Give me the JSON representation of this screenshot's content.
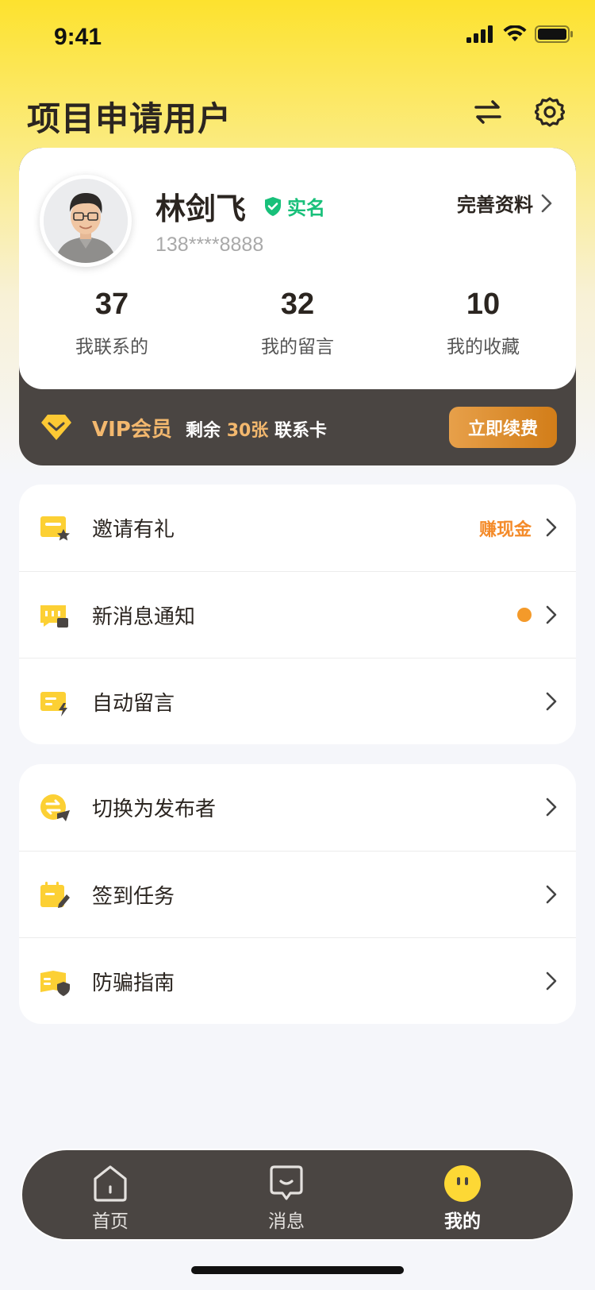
{
  "status_bar": {
    "time": "9:41"
  },
  "header": {
    "title": "项目申请用户",
    "switch_icon": "switch-arrows-icon",
    "settings_icon": "gear-icon"
  },
  "profile": {
    "name": "林剑飞",
    "verified_label": "实名",
    "phone": "138****8888",
    "complete_label": "完善资料",
    "stats": [
      {
        "value": "37",
        "label": "我联系的"
      },
      {
        "value": "32",
        "label": "我的留言"
      },
      {
        "value": "10",
        "label": "我的收藏"
      }
    ]
  },
  "vip": {
    "title": "VIP会员",
    "remaining_prefix": "剩余",
    "remaining_count": "30张",
    "remaining_suffix": "联系卡",
    "renew_label": "立即续费"
  },
  "menu_group_1": [
    {
      "label": "邀请有礼",
      "extra": "赚现金",
      "icon": "gift-card-icon"
    },
    {
      "label": "新消息通知",
      "icon": "message-notice-icon"
    },
    {
      "label": "自动留言",
      "icon": "auto-message-icon"
    }
  ],
  "menu_group_2": [
    {
      "label": "切换为发布者",
      "icon": "switch-publisher-icon"
    },
    {
      "label": "签到任务",
      "icon": "checkin-calendar-icon"
    },
    {
      "label": "防骗指南",
      "icon": "shield-guide-icon"
    }
  ],
  "tabbar": [
    {
      "label": "首页",
      "icon": "home-icon"
    },
    {
      "label": "消息",
      "icon": "chat-icon"
    },
    {
      "label": "我的",
      "icon": "profile-smile-icon",
      "active": true
    }
  ],
  "colors": {
    "accent_yellow": "#fdd835",
    "dark": "#4a4542",
    "vip_gold": "#f3b86e",
    "verified_green": "#18c07a",
    "earn_orange": "#f48b2a"
  }
}
